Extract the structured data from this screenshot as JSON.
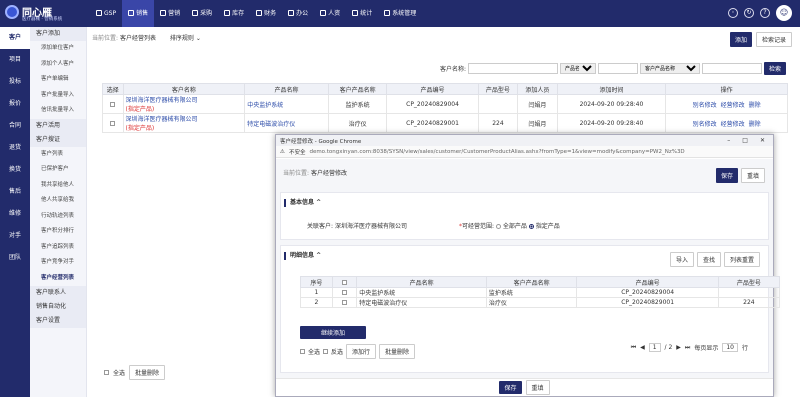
{
  "app": {
    "logo_title": "同心雁",
    "logo_sub": "医疗器械 · 营销系统"
  },
  "nav": [
    {
      "label": "GSP",
      "icon": "chart-icon"
    },
    {
      "label": "销售",
      "icon": "sales-icon"
    },
    {
      "label": "营销",
      "icon": "megaphone-icon"
    },
    {
      "label": "采购",
      "icon": "cart-icon"
    },
    {
      "label": "库存",
      "icon": "box-icon"
    },
    {
      "label": "财务",
      "icon": "money-icon"
    },
    {
      "label": "办公",
      "icon": "office-icon"
    },
    {
      "label": "人资",
      "icon": "people-icon"
    },
    {
      "label": "统计",
      "icon": "stats-icon"
    },
    {
      "label": "系统管理",
      "icon": "gear-icon"
    }
  ],
  "sidebar": [
    "客户",
    "项目",
    "投标",
    "报价",
    "合同",
    "退货",
    "换货",
    "售后",
    "维修",
    "对手",
    "团队"
  ],
  "subnav": {
    "group1": "客户添加",
    "group1_items": [
      "添加单位客户",
      "添加个人客户",
      "客户单编辑",
      "客户批量导入",
      "信讯批量导入"
    ],
    "group2": "客户活用",
    "group3": "客户搜证",
    "group3_items": [
      "客户列表",
      "已保护客户",
      "我共享给他人",
      "他人共享给我",
      "行动轨迹列表",
      "客户积分排行",
      "客户追踪列表",
      "客户竞争对手",
      "客户经营列表"
    ],
    "group4": "客户联系人",
    "group5": "销售自动化",
    "group6": "客户设置"
  },
  "main": {
    "breadcrumb_label": "当前位置:",
    "breadcrumb_value": "客户经营列表",
    "sort_label": "排序规则",
    "add_button": "添加",
    "history_button": "检索记录",
    "search": {
      "name_label": "客户名称:",
      "product_select": "产品名称",
      "product_name_select": "客户产品名称",
      "search_button": "检索"
    },
    "columns": [
      "选择",
      "客户名称",
      "产品名称",
      "客户产品名称",
      "产品编号",
      "产品型号",
      "添加人员",
      "添加时间",
      "操作"
    ],
    "rows": [
      {
        "customer": "深圳海洋医疗器械有限公司",
        "tag": "(指定产品)",
        "product": "中央监护系统",
        "cust_product": "监护系统",
        "code": "CP_20240829004",
        "model": "",
        "person": "闫娟月",
        "time": "2024-09-20 09:28:40",
        "ops": [
          "别名修改",
          "经营修改",
          "删除"
        ]
      },
      {
        "customer": "深圳海洋医疗器械有限公司",
        "tag": "(指定产品)",
        "product": "特定电磁波治疗仪",
        "cust_product": "治疗仪",
        "code": "CP_20240829001",
        "model": "224",
        "person": "闫娟月",
        "time": "2024-09-20 09:28:40",
        "ops": [
          "别名修改",
          "经营修改",
          "删除"
        ]
      }
    ],
    "footer": {
      "select_all": "全选",
      "batch_delete": "批量删除"
    }
  },
  "popup": {
    "window_title": "客户经营修改 - Google Chrome",
    "insecure": "不安全",
    "url": "demo.tongxinyan.com:8038/SYSN/view/sales/customer/CustomerProductAlias.ashx?fromType=1&view=modify&company=PW2_Nz%3D",
    "breadcrumb_label": "当前位置:",
    "breadcrumb_value": "客户经营修改",
    "save": "保存",
    "reset": "重填",
    "basic": {
      "title": "基本信息",
      "customer_label": "关联客户:",
      "customer_value": "深圳海洋医疗器械有限公司",
      "scope_label": "可经营范围:",
      "scope_all": "全部产品",
      "scope_part": "指定产品"
    },
    "detail": {
      "title": "明细信息",
      "import": "导入",
      "find": "查找",
      "columns_reset": "列表重置",
      "columns": [
        "序号",
        "",
        "产品名称",
        "客户产品名称",
        "产品编号",
        "产品型号"
      ],
      "rows": [
        {
          "no": "1",
          "product": "中央监护系统",
          "cust": "监护系统",
          "code": "CP_20240829004",
          "model": ""
        },
        {
          "no": "2",
          "product": "特定电磁波治疗仪",
          "cust": "治疗仪",
          "code": "CP_20240829001",
          "model": "224"
        }
      ],
      "continue_add": "继续添加",
      "ops": [
        "全选",
        "反选",
        "添加行",
        "批量删除"
      ],
      "pager_page": "1",
      "pager_total": "/ 2",
      "per_page_label": "每页显示",
      "per_page": "10",
      "rows_unit": "行"
    }
  }
}
